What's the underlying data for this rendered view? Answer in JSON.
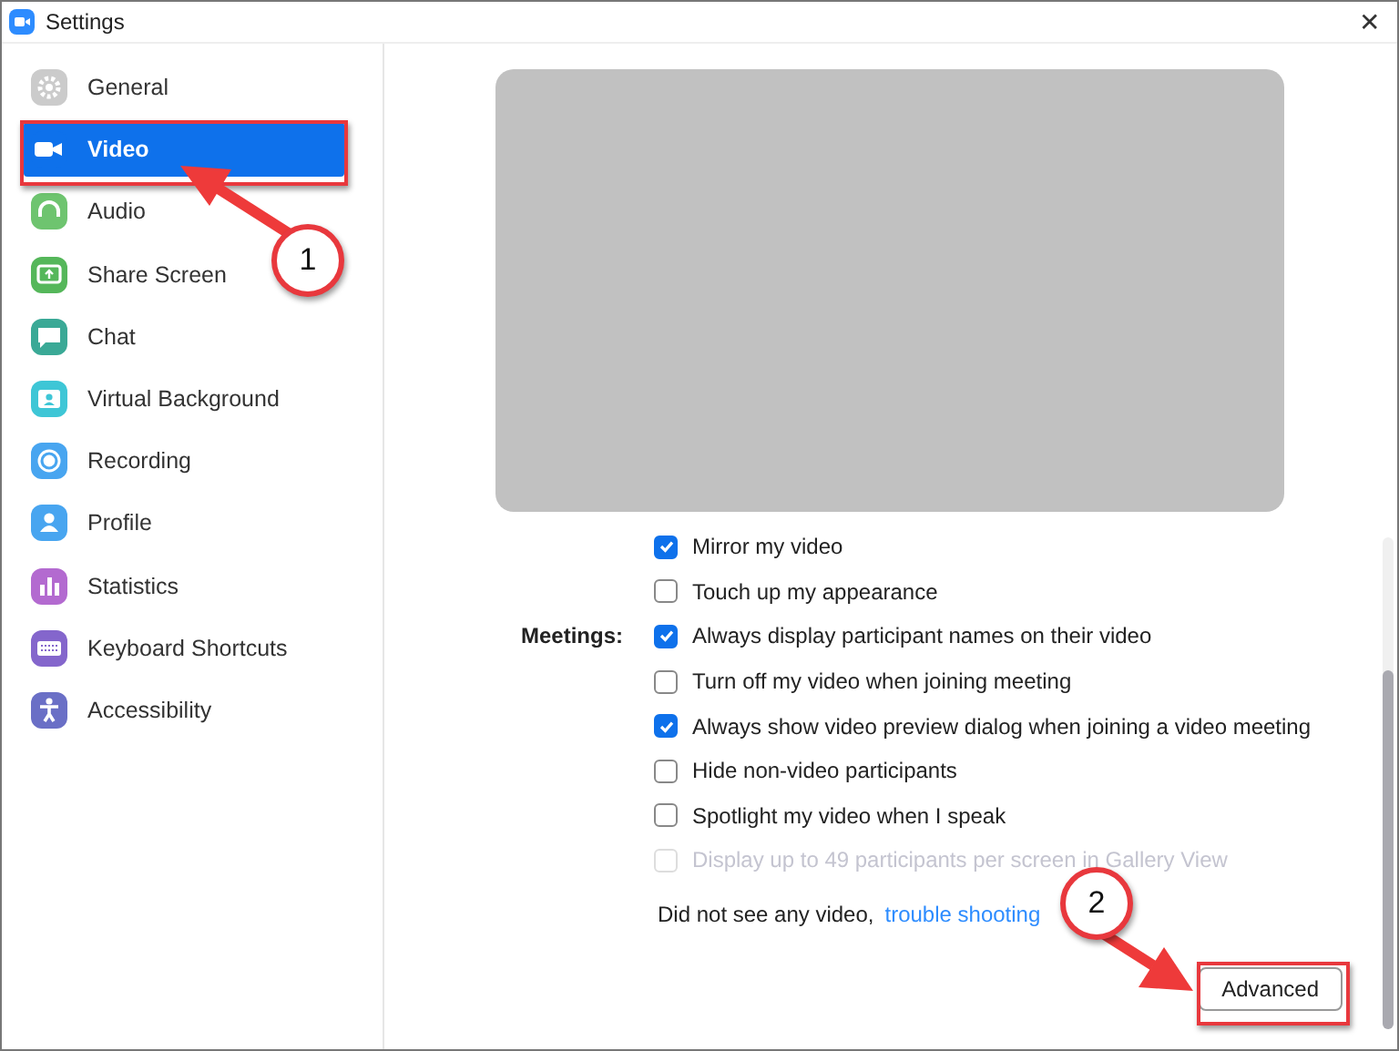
{
  "window": {
    "title": "Settings",
    "close": "✕"
  },
  "sidebar": {
    "items": [
      {
        "label": "General",
        "selected": false,
        "color": "#cbcbcb"
      },
      {
        "label": "Video",
        "selected": true,
        "color": "#0e71eb"
      },
      {
        "label": "Audio",
        "selected": false,
        "color": "#6ec46f"
      },
      {
        "label": "Share Screen",
        "selected": false,
        "color": "#55b75a"
      },
      {
        "label": "Chat",
        "selected": false,
        "color": "#3aa996"
      },
      {
        "label": "Virtual Background",
        "selected": false,
        "color": "#3ec6d6"
      },
      {
        "label": "Recording",
        "selected": false,
        "color": "#48a5f0"
      },
      {
        "label": "Profile",
        "selected": false,
        "color": "#48a5f0"
      },
      {
        "label": "Statistics",
        "selected": false,
        "color": "#b36ad0"
      },
      {
        "label": "Keyboard Shortcuts",
        "selected": false,
        "color": "#8466cc"
      },
      {
        "label": "Accessibility",
        "selected": false,
        "color": "#6a6fc6"
      }
    ]
  },
  "video_options": [
    {
      "label": "Mirror my video",
      "checked": true,
      "disabled": false
    },
    {
      "label": "Touch up my appearance",
      "checked": false,
      "disabled": false
    }
  ],
  "meetings": {
    "label": "Meetings:",
    "options": [
      {
        "label": "Always display participant names on their video",
        "checked": true,
        "disabled": false
      },
      {
        "label": "Turn off my video when joining meeting",
        "checked": false,
        "disabled": false
      },
      {
        "label": "Always show video preview dialog when joining a video meeting",
        "checked": true,
        "disabled": false
      },
      {
        "label": "Hide non-video participants",
        "checked": false,
        "disabled": false
      },
      {
        "label": "Spotlight my video when I speak",
        "checked": false,
        "disabled": false
      },
      {
        "label": "Display up to 49 participants per screen in Gallery View",
        "checked": false,
        "disabled": true
      }
    ]
  },
  "troubleshoot": {
    "text": "Did not see any video,",
    "link": "trouble shooting"
  },
  "advanced_button": "Advanced",
  "callouts": [
    {
      "label": "1"
    },
    {
      "label": "2"
    }
  ]
}
